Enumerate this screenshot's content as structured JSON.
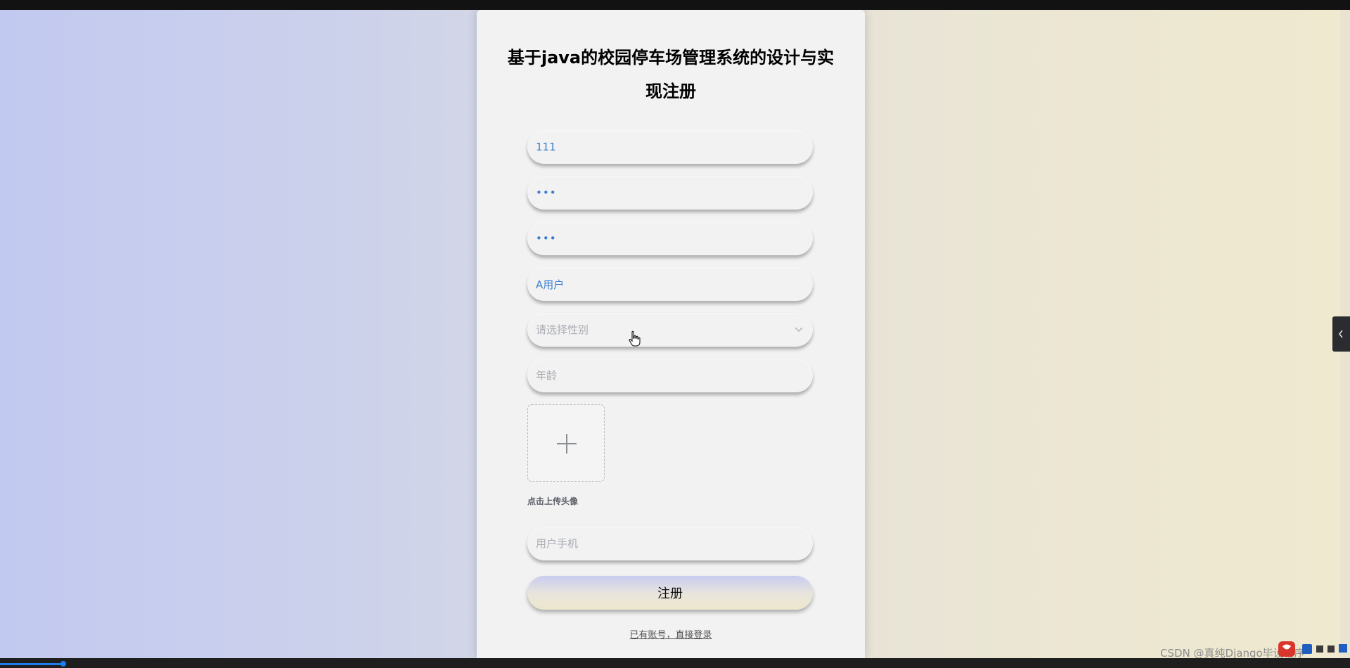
{
  "form": {
    "title": "基于java的校园停车场管理系统的设计与实现注册",
    "username_value": "111",
    "password_value": "•••",
    "confirm_password_value": "•••",
    "name_value": "A用户",
    "gender_placeholder": "请选择性别",
    "age_placeholder": "年龄",
    "upload_label": "点击上传头像",
    "phone_placeholder": "用户手机",
    "submit_label": "注册",
    "login_link": "已有账号，直接登录"
  },
  "overlay": {
    "watermark": "CSDN @真纯Django毕设程序"
  },
  "icons": {
    "gender_chevron": "chevron-down-icon",
    "upload": "plus-icon",
    "side_toggle": "chevron-left-icon",
    "cursor": "hand-pointer-icon"
  },
  "colors": {
    "input_text": "#3a7ccf",
    "placeholder": "#a9acb2",
    "card_bg": "#f2f2f2",
    "gradient_left": "#c2c9f0",
    "gradient_right": "#efe9cf"
  }
}
